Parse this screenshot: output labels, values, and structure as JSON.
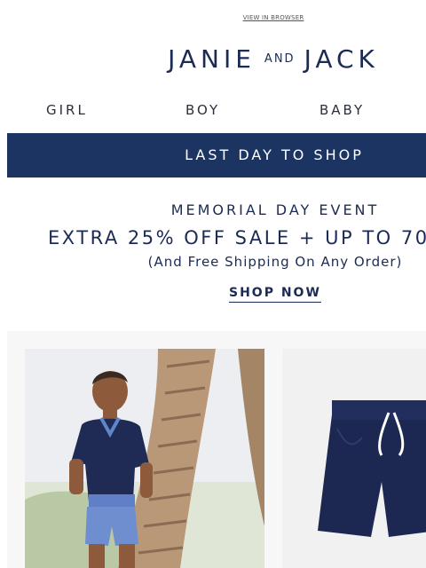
{
  "header": {
    "view_in_browser": "VIEW IN BROWSER",
    "logo": {
      "left": "JANIE",
      "middle": "AND",
      "right": "JACK"
    }
  },
  "nav": {
    "items": [
      {
        "label": "GIRL"
      },
      {
        "label": "BOY"
      },
      {
        "label": "BABY"
      }
    ]
  },
  "banner": {
    "label": "LAST DAY TO SHOP",
    "color": "#1b3461"
  },
  "promo": {
    "event_title": "MEMORIAL DAY EVENT",
    "headline": "EXTRA 25% OFF SALE + UP TO 70",
    "subline": "(And Free Shipping On Any Order)",
    "cta": "SHOP NOW"
  },
  "colors": {
    "navy": "#1b2b53",
    "background": "#ffffff"
  }
}
